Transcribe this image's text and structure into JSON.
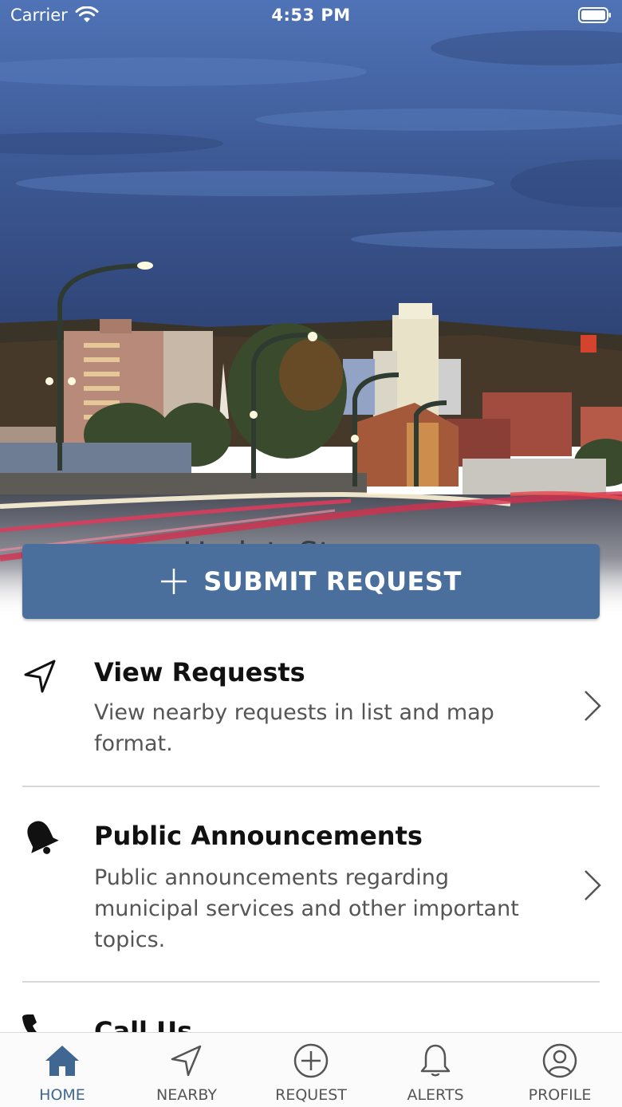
{
  "status_bar": {
    "carrier": "Carrier",
    "time": "4:53 PM"
  },
  "watermark": "UpdateStar.com",
  "submit_button": {
    "label": "SUBMIT REQUEST",
    "icon": "plus-icon"
  },
  "menu": [
    {
      "title": "View Requests",
      "description": "View nearby requests in list and map format.",
      "icon": "navigation-arrow-icon"
    },
    {
      "title": "Public Announcements",
      "description": "Public announcements  regarding municipal services and other important topics.",
      "icon": "bell-icon"
    },
    {
      "title": "Call Us",
      "icon": "phone-icon"
    }
  ],
  "tabs": [
    {
      "label": "HOME",
      "icon": "home-icon",
      "active": true
    },
    {
      "label": "NEARBY",
      "icon": "navigation-arrow-icon"
    },
    {
      "label": "REQUEST",
      "icon": "plus-circle-icon"
    },
    {
      "label": "ALERTS",
      "icon": "bell-icon"
    },
    {
      "label": "PROFILE",
      "icon": "user-circle-icon"
    }
  ],
  "colors": {
    "accent": "#4a6f9c",
    "active_tab": "#3f6791",
    "sky": "#4b6aa6"
  }
}
